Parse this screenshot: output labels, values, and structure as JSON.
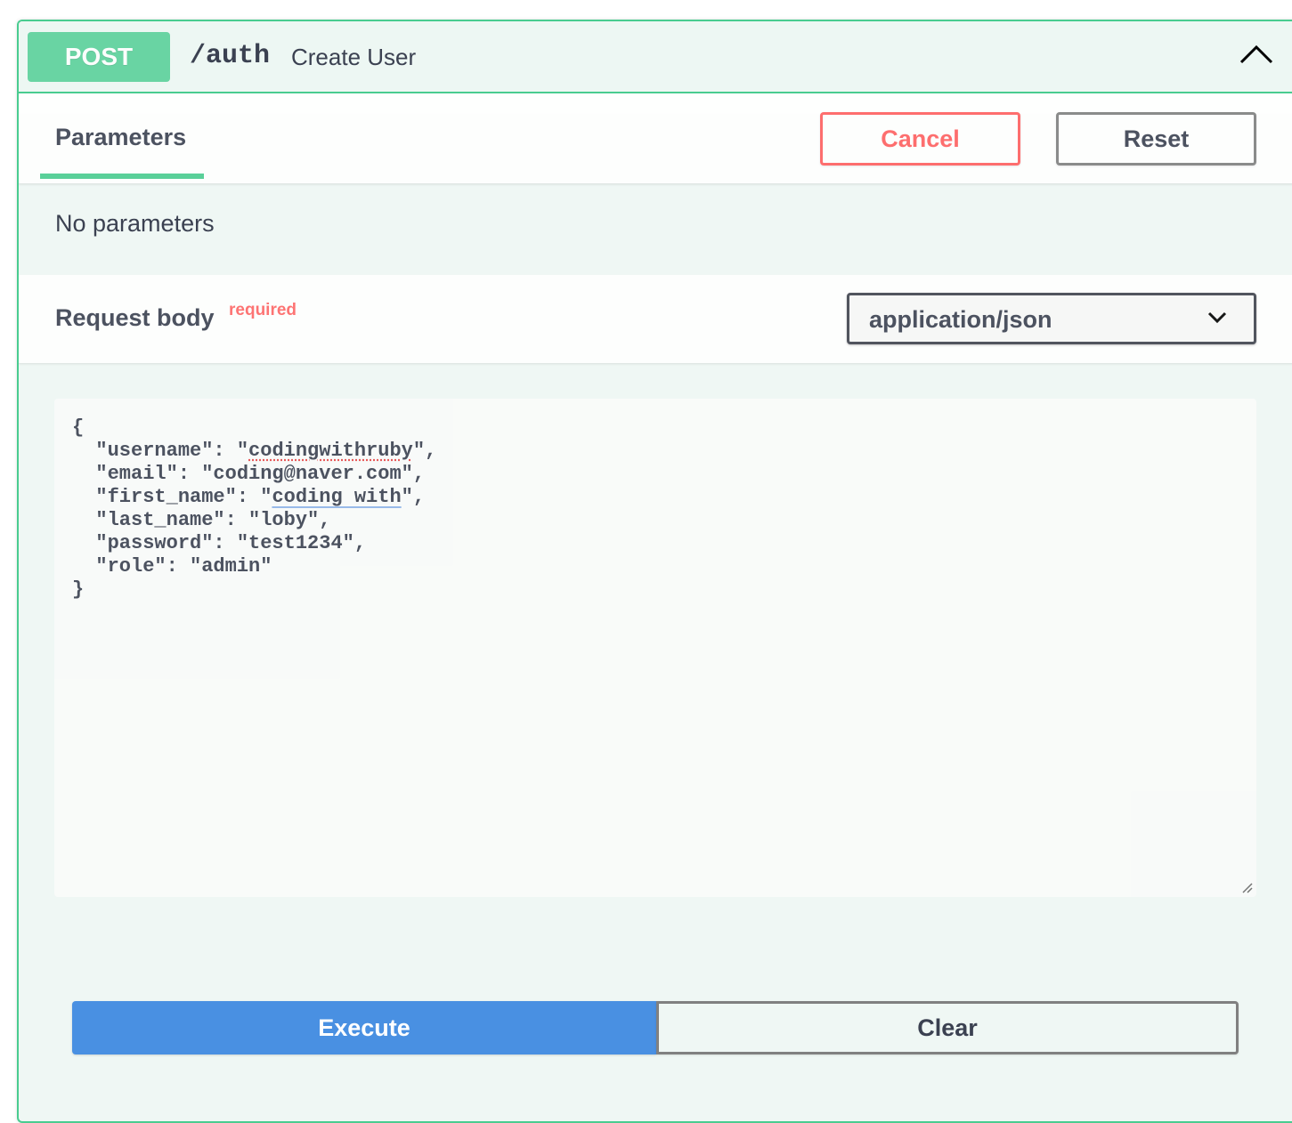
{
  "operation": {
    "method": "POST",
    "path": "/auth",
    "summary": "Create User",
    "method_color": "#49cc90"
  },
  "parameters": {
    "tab_label": "Parameters",
    "cancel_label": "Cancel",
    "reset_label": "Reset",
    "empty_text": "No parameters"
  },
  "request_body": {
    "title": "Request body",
    "required_label": "required",
    "content_type": "application/json",
    "lines": [
      {
        "pre": "{",
        "mark": "",
        "post": "",
        "style": ""
      },
      {
        "pre": "  \"username\": \"",
        "mark": "codingwithruby",
        "post": "\",",
        "style": "spell-red"
      },
      {
        "pre": "  \"email\": \"coding@naver.com\",",
        "mark": "",
        "post": "",
        "style": ""
      },
      {
        "pre": "  \"first_name\": \"",
        "mark": "coding with",
        "post": "\",",
        "style": "spell-blue"
      },
      {
        "pre": "  \"last_name\": \"loby\",",
        "mark": "",
        "post": "",
        "style": ""
      },
      {
        "pre": "  \"password\": \"test1234\",",
        "mark": "",
        "post": "",
        "style": ""
      },
      {
        "pre": "  \"role\": \"admin\"",
        "mark": "",
        "post": "",
        "style": ""
      },
      {
        "pre": "}",
        "mark": "",
        "post": "",
        "style": ""
      }
    ]
  },
  "actions": {
    "execute_label": "Execute",
    "clear_label": "Clear",
    "execute_color": "#4990e2"
  },
  "icons": {
    "collapse": "chevron-up-icon",
    "select": "chevron-down-icon",
    "resize": "resize-handle-icon"
  }
}
